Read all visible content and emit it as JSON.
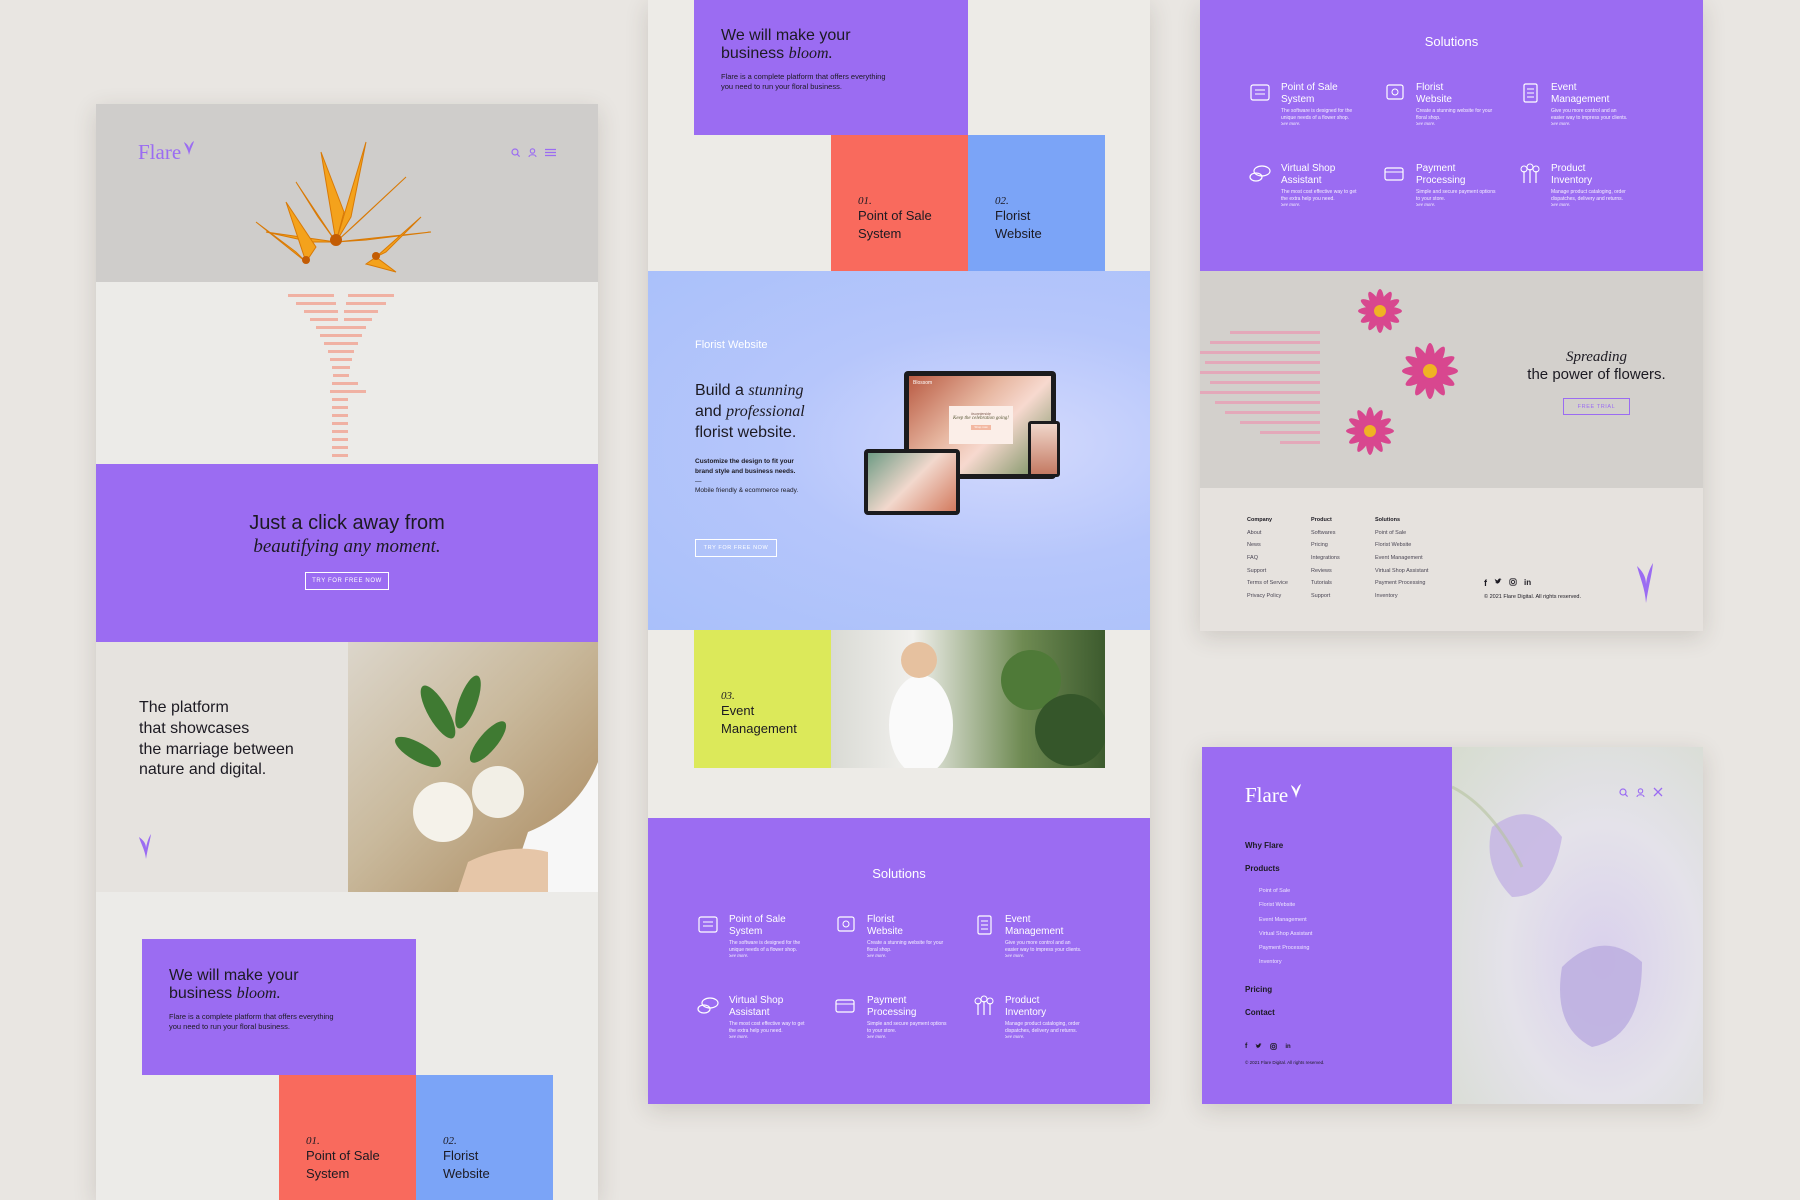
{
  "brand": {
    "name": "Flare"
  },
  "colors": {
    "purple": "#9b6cf2",
    "coral": "#f96a5d",
    "blue": "#7ba4f7",
    "lime": "#dce95a",
    "offwhite": "#edebe7"
  },
  "icons": [
    "search-icon",
    "user-icon",
    "menu-icon",
    "close-icon",
    "flare-flower-icon",
    "facebook-icon",
    "twitter-icon",
    "instagram-icon",
    "linkedin-icon"
  ],
  "home": {
    "hero_title_line1": "Just a click away from",
    "hero_title_line2": "beautifying any moment.",
    "cta": "TRY FOR FREE NOW",
    "platform_text": [
      "The platform",
      "that showcases",
      "the marriage between",
      "nature and digital."
    ]
  },
  "bloom": {
    "title_line1": "We will make your",
    "title_plain": "business",
    "title_italic": "bloom.",
    "description_line1": "Flare is a complete platform that offers everything",
    "description_line2": "you need to run your floral business."
  },
  "tiles": [
    {
      "num": "01.",
      "line1": "Point of Sale",
      "line2": "System"
    },
    {
      "num": "02.",
      "line1": "Florist",
      "line2": "Website"
    },
    {
      "num": "03.",
      "line1": "Event",
      "line2": "Management"
    }
  ],
  "florist_site": {
    "label": "Florist Website",
    "title_l1_plain": "Build a",
    "title_l1_italic": "stunning",
    "title_l2_plain": "and",
    "title_l2_italic": "professional",
    "title_l3": "florist website.",
    "desc_line1": "Customize the design to fit your",
    "desc_line2": "brand style and business needs.",
    "dash": "—",
    "note": "Mobile friendly & ecommerce ready.",
    "cta": "TRY FOR FREE NOW",
    "mock_brand": "Blossom",
    "mock_script": "Keep the celebration going!",
    "mock_tag": "#sunnierside",
    "mock_button": "Shop now"
  },
  "solutions": {
    "title": "Solutions",
    "items": [
      {
        "l1": "Point of Sale",
        "l2": "System",
        "desc": "The software is designed for the unique needs of a flower shop.",
        "more": "See more."
      },
      {
        "l1": "Florist",
        "l2": "Website",
        "desc": "Create a stunning website for your floral shop.",
        "more": "See more."
      },
      {
        "l1": "Event",
        "l2": "Management",
        "desc": "Give you more control and an easier way to impress your clients.",
        "more": "See more."
      },
      {
        "l1": "Virtual Shop",
        "l2": "Assistant",
        "desc": "The most cost effective way to get the extra help you need.",
        "more": "See more."
      },
      {
        "l1": "Payment",
        "l2": "Processing",
        "desc": "Simple and secure payment options to your store.",
        "more": "See more."
      },
      {
        "l1": "Product",
        "l2": "Inventory",
        "desc": "Manage product cataloging, order dispatches, delivery and returns.",
        "more": "See more."
      }
    ]
  },
  "spreading": {
    "line1": "Spreading",
    "line2": "the power of flowers.",
    "cta": "FREE TRIAL"
  },
  "footer": {
    "columns": [
      {
        "head": "Company",
        "items": [
          "About",
          "News",
          "FAQ",
          "Support",
          "Terms of Service",
          "Privacy Policy"
        ]
      },
      {
        "head": "Product",
        "items": [
          "Softwares",
          "Pricing",
          "Integrations",
          "Reviews",
          "Tutorials",
          "Support"
        ]
      },
      {
        "head": "Solutions",
        "items": [
          "Point of Sale",
          "Florist Website",
          "Event Management",
          "Virtual Shop Assistant",
          "Payment Processing",
          "Inventory"
        ]
      }
    ],
    "copyright": "© 2021 Flare Digital. All rights reserved."
  },
  "menu": {
    "why": "Why Flare",
    "products": "Products",
    "sub": [
      "Point of Sale",
      "Florist Website",
      "Event Management",
      "Virtual Shop Assistant",
      "Payment Processing",
      "Inventory"
    ],
    "pricing": "Pricing",
    "contact": "Contact",
    "copyright": "© 2021 Flare Digital. All rights reserved."
  }
}
